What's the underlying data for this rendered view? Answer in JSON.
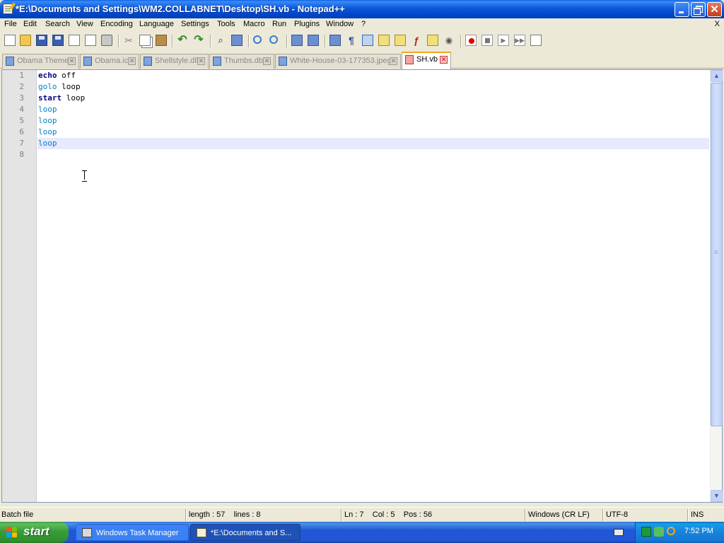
{
  "window": {
    "title": "*E:\\Documents and Settings\\WM2.COLLABNET\\Desktop\\SH.vb - Notepad++",
    "close_glyph": "✕"
  },
  "menu": {
    "items": [
      "File",
      "Edit",
      "Search",
      "View",
      "Encoding",
      "Language",
      "Settings",
      "Tools",
      "Macro",
      "Run",
      "Plugins",
      "Window",
      "?"
    ],
    "close_label": "X"
  },
  "tabs": [
    {
      "label": "Obama Theme",
      "active": false
    },
    {
      "label": "Obama.icl",
      "active": false
    },
    {
      "label": "Shellstyle.dll",
      "active": false
    },
    {
      "label": "Thumbs.db",
      "active": false
    },
    {
      "label": "White-House-03-177353.jpeg",
      "active": false
    },
    {
      "label": "SH.vb",
      "active": true
    }
  ],
  "tab_close_glyph": "✕",
  "editor": {
    "line_numbers": [
      "1",
      "2",
      "3",
      "4",
      "5",
      "6",
      "7",
      "8"
    ],
    "lines": [
      [
        {
          "text": "echo",
          "style": "kw"
        },
        {
          "text": " off",
          "style": "txt"
        }
      ],
      [
        {
          "text": "golo",
          "style": "cmd"
        },
        {
          "text": " loop",
          "style": "txt"
        }
      ],
      [
        {
          "text": "start",
          "style": "kw"
        },
        {
          "text": " loop",
          "style": "txt"
        }
      ],
      [
        {
          "text": "loop",
          "style": "cmd"
        }
      ],
      [
        {
          "text": "loop",
          "style": "cmd"
        }
      ],
      [
        {
          "text": "loop",
          "style": "cmd"
        }
      ],
      [
        {
          "text": "loop",
          "style": "cmd"
        }
      ],
      []
    ],
    "current_line": 7,
    "colors": {
      "keyword": "#000080",
      "command": "#0080c0",
      "current_line_bg": "#e8e8ff"
    }
  },
  "statusbar": {
    "language": "Batch file",
    "length_lines": "length : 57    lines : 8",
    "position": "Ln : 7    Col : 5    Pos : 56",
    "eol": "Windows (CR LF)",
    "encoding": "UTF-8",
    "mode": "INS"
  },
  "taskbar": {
    "start_label": "start",
    "tasks": [
      {
        "label": "Windows Task Manager",
        "active": false,
        "icon": "monitor-icon"
      },
      {
        "label": "*E:\\Documents and S...",
        "active": true,
        "icon": "notepad-icon"
      }
    ],
    "clock": "7:52 PM"
  },
  "icons": {
    "toolbar": [
      "new-file-icon",
      "open-file-icon",
      "save-icon",
      "save-all-icon",
      "close-icon",
      "close-all-icon",
      "print-icon",
      "cut-icon",
      "copy-icon",
      "paste-icon",
      "undo-icon",
      "redo-icon",
      "find-icon",
      "replace-icon",
      "zoom-in-icon",
      "zoom-out-icon",
      "sync-vertical-icon",
      "sync-horizontal-icon",
      "word-wrap-icon",
      "show-all-chars-icon",
      "indent-guide-icon",
      "user-lang-icon",
      "doc-map-icon",
      "function-list-icon",
      "folder-workspace-icon",
      "monitoring-icon",
      "record-macro-icon",
      "stop-record-icon",
      "play-macro-icon",
      "run-macro-multiple-icon",
      "save-macro-icon"
    ]
  }
}
